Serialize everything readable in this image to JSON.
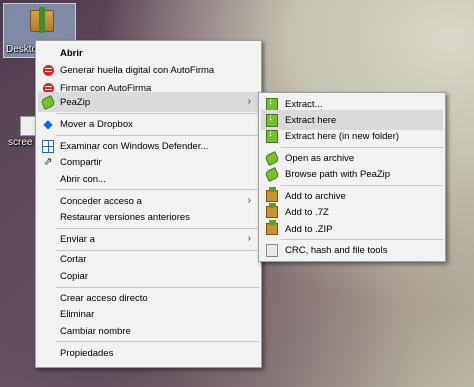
{
  "desktop": {
    "selected_icon_label": "Deskto",
    "other_icon_label": "scree"
  },
  "main_menu": {
    "items": [
      {
        "label": "Abrir",
        "icon": "open-icon"
      },
      {
        "label": "Generar huella digital con AutoFirma",
        "icon": "autofirma-icon"
      },
      {
        "label": "Firmar con AutoFirma",
        "icon": "autofirma-icon"
      },
      {
        "label": "PeaZip",
        "icon": "peazip-icon",
        "submenu": true
      },
      {
        "label": "Mover a Dropbox",
        "icon": "dropbox-icon"
      },
      {
        "label": "Examinar con Windows Defender...",
        "icon": "windows-defender-icon"
      },
      {
        "label": "Compartir",
        "icon": "share-icon"
      },
      {
        "label": "Abrir con...",
        "icon": ""
      },
      {
        "label": "Conceder acceso a",
        "icon": "",
        "submenu": true
      },
      {
        "label": "Restaurar versiones anteriores",
        "icon": ""
      },
      {
        "label": "Enviar a",
        "icon": "",
        "submenu": true
      },
      {
        "label": "Cortar",
        "icon": ""
      },
      {
        "label": "Copiar",
        "icon": ""
      },
      {
        "label": "Crear acceso directo",
        "icon": ""
      },
      {
        "label": "Eliminar",
        "icon": ""
      },
      {
        "label": "Cambiar nombre",
        "icon": ""
      },
      {
        "label": "Propiedades",
        "icon": ""
      }
    ]
  },
  "peazip_submenu": {
    "items": [
      {
        "label": "Extract...",
        "icon": "extract-icon"
      },
      {
        "label": "Extract here",
        "icon": "extract-icon"
      },
      {
        "label": "Extract here (in new folder)",
        "icon": "extract-icon"
      },
      {
        "label": "Open as archive",
        "icon": "peazip-icon"
      },
      {
        "label": "Browse path with PeaZip",
        "icon": "peazip-icon"
      },
      {
        "label": "Add to archive",
        "icon": "archive-icon"
      },
      {
        "label": "Add to .7Z",
        "icon": "archive-icon"
      },
      {
        "label": "Add to .ZIP",
        "icon": "archive-icon"
      },
      {
        "label": "CRC, hash and file tools",
        "icon": "crc-icon"
      }
    ]
  },
  "submenu_arrow": "›",
  "colors": {
    "menu_bg": "#f2f2f2",
    "highlight": "#dadada",
    "autofirma_red": "#d8262a",
    "peazip_green": "#7bbd2c",
    "dropbox_blue": "#0061fe"
  }
}
